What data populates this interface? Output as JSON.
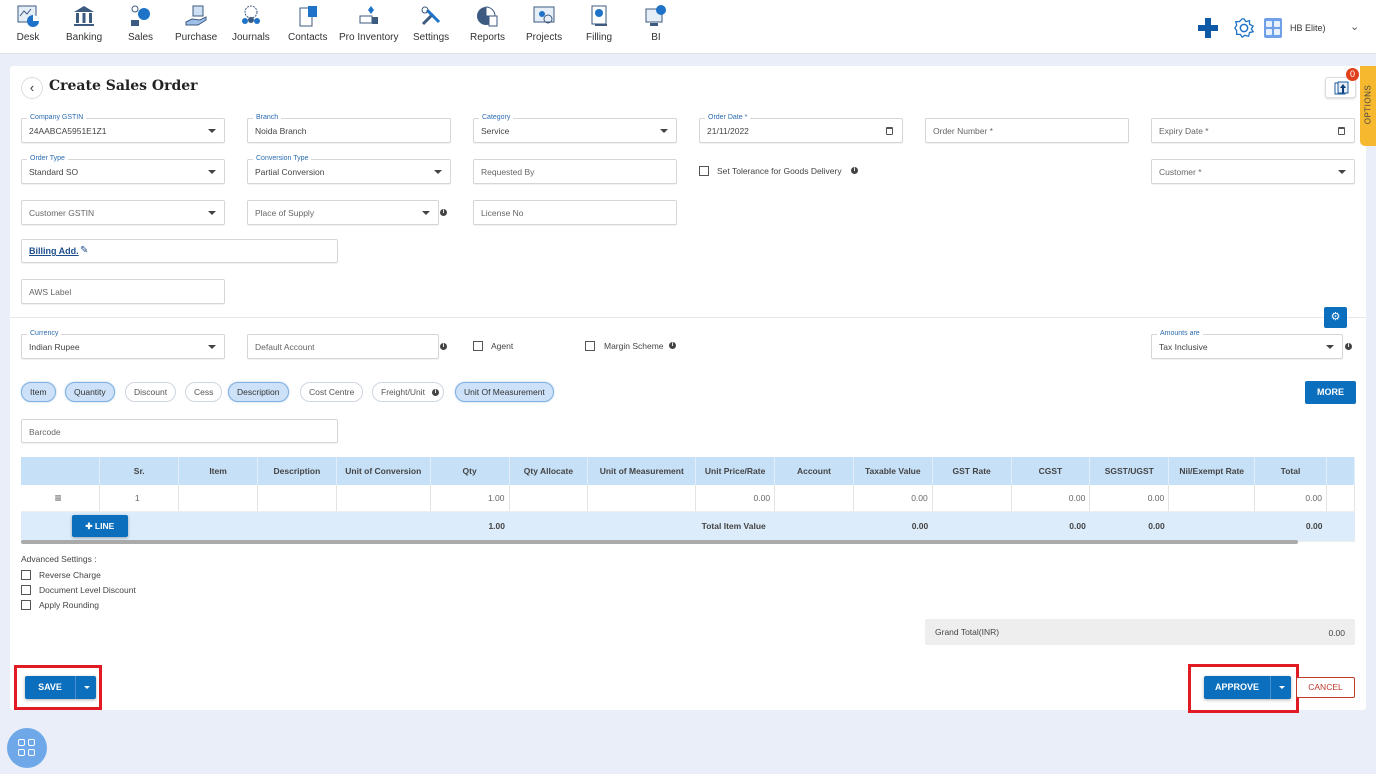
{
  "nav": {
    "items": [
      {
        "label": "Desk",
        "icon": "desk-icon"
      },
      {
        "label": "Banking",
        "icon": "bank-icon"
      },
      {
        "label": "Sales",
        "icon": "sales-icon"
      },
      {
        "label": "Purchase",
        "icon": "purchase-icon"
      },
      {
        "label": "Journals",
        "icon": "journals-icon"
      },
      {
        "label": "Contacts",
        "icon": "contacts-icon"
      },
      {
        "label": "Pro Inventory",
        "icon": "inventory-icon"
      },
      {
        "label": "Settings",
        "icon": "settings-icon"
      },
      {
        "label": "Reports",
        "icon": "reports-icon"
      },
      {
        "label": "Projects",
        "icon": "projects-icon"
      },
      {
        "label": "Filling",
        "icon": "filling-icon"
      },
      {
        "label": "BI",
        "icon": "bi-icon"
      }
    ],
    "org_label": "HB Elite)",
    "accent": "#0e5aa6"
  },
  "page": {
    "title": "Create Sales Order",
    "options_tab": "OPTIONS",
    "notification_count": "0"
  },
  "form": {
    "company_gstin": {
      "label": "Company GSTIN",
      "value": "24AABCA5951E1Z1"
    },
    "branch": {
      "label": "Branch",
      "value": "Noida Branch"
    },
    "category": {
      "label": "Category",
      "value": "Service"
    },
    "order_date": {
      "label": "Order Date *",
      "value": "21/11/2022"
    },
    "order_number": {
      "placeholder": "Order Number *"
    },
    "expiry_date": {
      "placeholder": "Expiry Date *"
    },
    "order_type": {
      "label": "Order Type",
      "value": "Standard SO"
    },
    "conversion_type": {
      "label": "Conversion Type",
      "value": "Partial Conversion"
    },
    "requested_by": {
      "placeholder": "Requested By"
    },
    "tolerance": {
      "label": "Set Tolerance for Goods Delivery",
      "checked": false
    },
    "customer": {
      "placeholder": "Customer *"
    },
    "customer_gstin": {
      "placeholder": "Customer GSTIN"
    },
    "place_of_supply": {
      "placeholder": "Place of Supply"
    },
    "license_no": {
      "placeholder": "License No"
    },
    "billing_add": "Billing Add.",
    "aws_label": {
      "placeholder": "AWS Label"
    },
    "currency": {
      "label": "Currency",
      "value": "Indian Rupee"
    },
    "default_account": {
      "placeholder": "Default Account"
    },
    "agent": {
      "label": "Agent",
      "checked": false
    },
    "margin_scheme": {
      "label": "Margin Scheme",
      "checked": false
    },
    "amounts_are": {
      "label": "Amounts are",
      "value": "Tax Inclusive"
    }
  },
  "columns_toggle": [
    {
      "label": "Item",
      "active": true
    },
    {
      "label": "Quantity",
      "active": true
    },
    {
      "label": "Discount",
      "active": false
    },
    {
      "label": "Cess",
      "active": false
    },
    {
      "label": "Description",
      "active": true
    },
    {
      "label": "Cost Centre",
      "active": false
    },
    {
      "label": "Freight/Unit",
      "active": false
    },
    {
      "label": "Unit Of Measurement",
      "active": true
    }
  ],
  "more_label": "MORE",
  "barcode": {
    "placeholder": "Barcode"
  },
  "table": {
    "headers": [
      "",
      "Sr.",
      "Item",
      "Description",
      "Unit of Conversion",
      "Qty",
      "Qty Allocate",
      "Unit of Measurement",
      "Unit Price/Rate",
      "Account",
      "Taxable Value",
      "GST Rate",
      "CGST",
      "SGST/UGST",
      "Nil/Exempt Rate",
      "Total"
    ],
    "rows": [
      {
        "sr": "1",
        "item": "",
        "description": "",
        "unit_conversion": "",
        "qty": "1.00",
        "qty_allocate": "",
        "uom": "",
        "unit_price": "0.00",
        "account": "",
        "taxable_value": "0.00",
        "gst_rate": "",
        "cgst": "0.00",
        "sgst": "0.00",
        "nil_exempt": "",
        "total": "0.00"
      }
    ],
    "add_line_label": "LINE",
    "totals": {
      "qty": "1.00",
      "label": "Total Item Value",
      "taxable_value": "0.00",
      "cgst": "0.00",
      "sgst": "0.00",
      "total": "0.00"
    }
  },
  "advanced": {
    "title": "Advanced Settings :",
    "options": [
      {
        "label": "Reverse Charge",
        "checked": false
      },
      {
        "label": "Document Level Discount",
        "checked": false
      },
      {
        "label": "Apply Rounding",
        "checked": false
      }
    ]
  },
  "grand_total": {
    "label": "Grand Total(INR)",
    "value": "0.00"
  },
  "actions": {
    "save": "SAVE",
    "approve": "APPROVE",
    "cancel": "CANCEL"
  }
}
